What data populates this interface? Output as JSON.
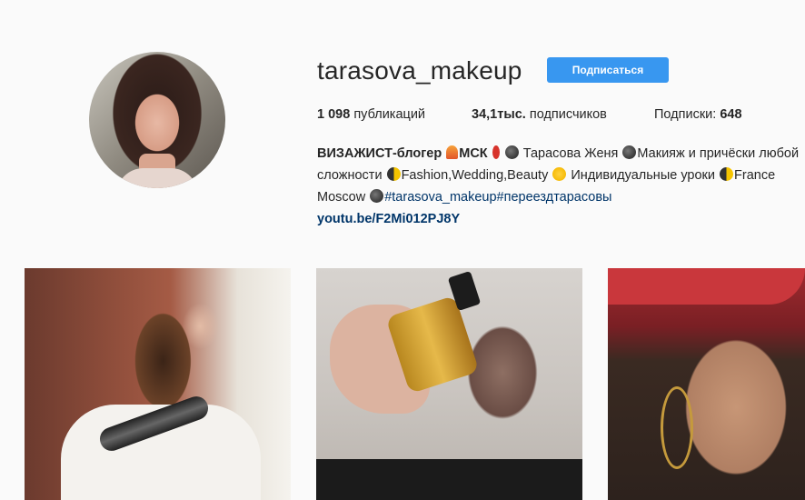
{
  "profile": {
    "username": "tarasova_makeup",
    "follow_label": "Подписаться",
    "accent_color": "#3897f0"
  },
  "stats": {
    "posts_count": "1 098",
    "posts_label": " публикаций",
    "followers_count": "34,1тыс.",
    "followers_label": " подписчиков",
    "following_label": "Подписки: ",
    "following_count": "648"
  },
  "bio": {
    "line1_bold": "ВИЗАЖИСТ-блогер",
    "line1_city": "МСК",
    "line1_name": " Тарасова Женя ",
    "line1_rest": "Макияж и причёски любой",
    "line2_a": "сложности ",
    "line2_b": "Fashion,Wedding,Beauty ",
    "line2_c": " Индивидуальные уроки ",
    "line2_d": "France",
    "line3_city": "Moscow ",
    "line3_tags": "#tarasova_makeup#переездтарасовы",
    "link": "youtu.be/F2Mi012PJ8Y"
  },
  "icons": [
    "bell-emoji-icon",
    "pin-emoji-icon",
    "moon-emoji-icon",
    "sun-emoji-icon"
  ],
  "posts": [
    "post-hair-brush",
    "post-oil-bottle",
    "post-red-hat"
  ]
}
